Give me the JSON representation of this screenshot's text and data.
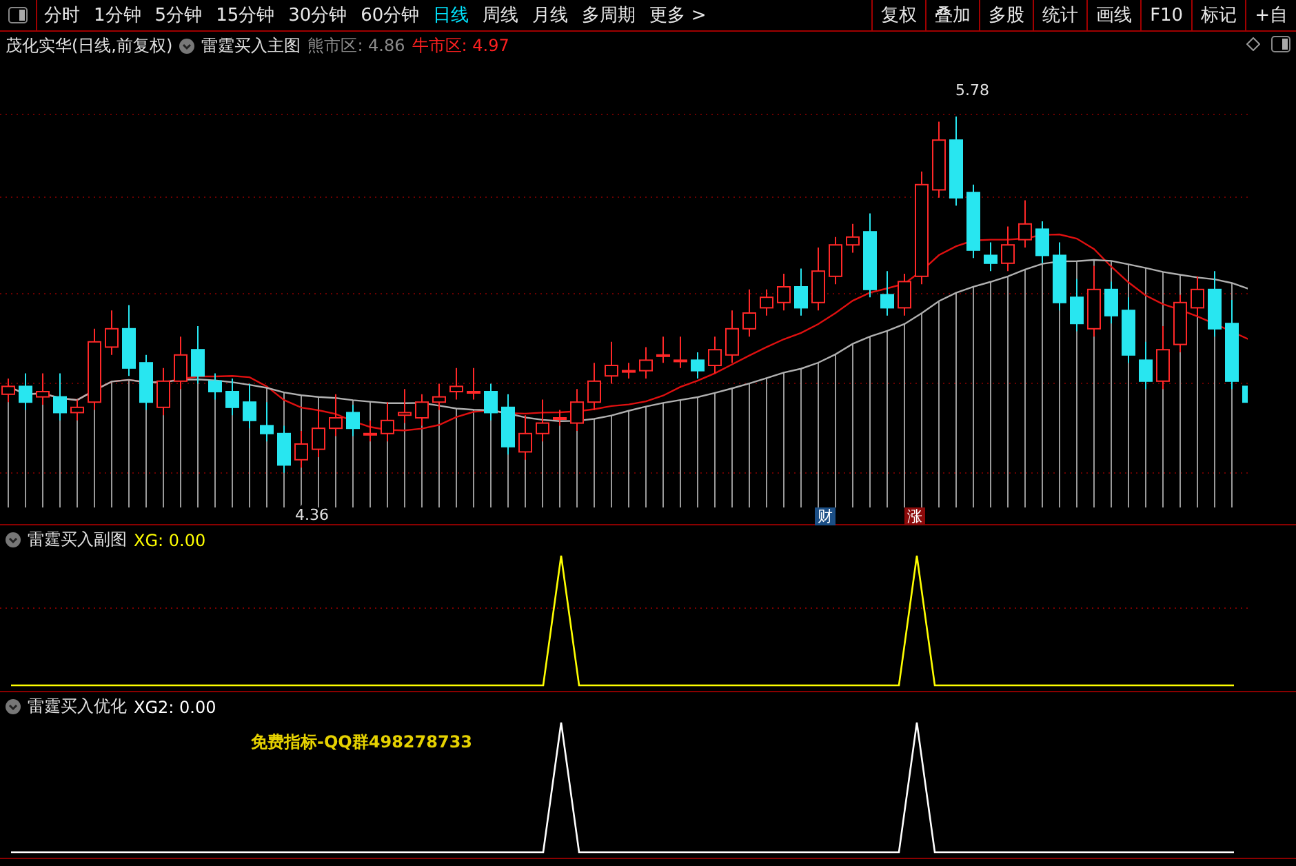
{
  "toolbar": {
    "periods": [
      {
        "label": "分时",
        "selected": false
      },
      {
        "label": "1分钟",
        "selected": false
      },
      {
        "label": "5分钟",
        "selected": false
      },
      {
        "label": "15分钟",
        "selected": false
      },
      {
        "label": "30分钟",
        "selected": false
      },
      {
        "label": "60分钟",
        "selected": false
      },
      {
        "label": "日线",
        "selected": true
      },
      {
        "label": "周线",
        "selected": false
      },
      {
        "label": "月线",
        "selected": false
      },
      {
        "label": "多周期",
        "selected": false
      },
      {
        "label": "更多 >",
        "selected": false
      }
    ],
    "tools": [
      "复权",
      "叠加",
      "多股",
      "统计",
      "画线",
      "F10",
      "标记",
      "+自"
    ]
  },
  "main_chart": {
    "stock": "茂化实华(日线,前复权)",
    "indicator": "雷霆买入主图",
    "legend": [
      {
        "label": "熊市区: ",
        "value": "4.86",
        "color": "#8c8c8c"
      },
      {
        "label": "牛市区: ",
        "value": "4.97",
        "color": "#ff2020"
      }
    ],
    "high_label": "5.78",
    "low_label": "4.36",
    "markers": [
      {
        "text": "财",
        "color": "#1c4f86"
      },
      {
        "text": "涨",
        "color": "#8c0a0a"
      }
    ]
  },
  "sub_charts": [
    {
      "title": "雷霆买入副图",
      "reading": "XG: 0.00",
      "color": "#ffff00"
    },
    {
      "title": "雷霆买入优化",
      "reading": "XG2: 0.00",
      "color": "#ffffff",
      "note": "免费指标-QQ群498278733"
    }
  ]
}
